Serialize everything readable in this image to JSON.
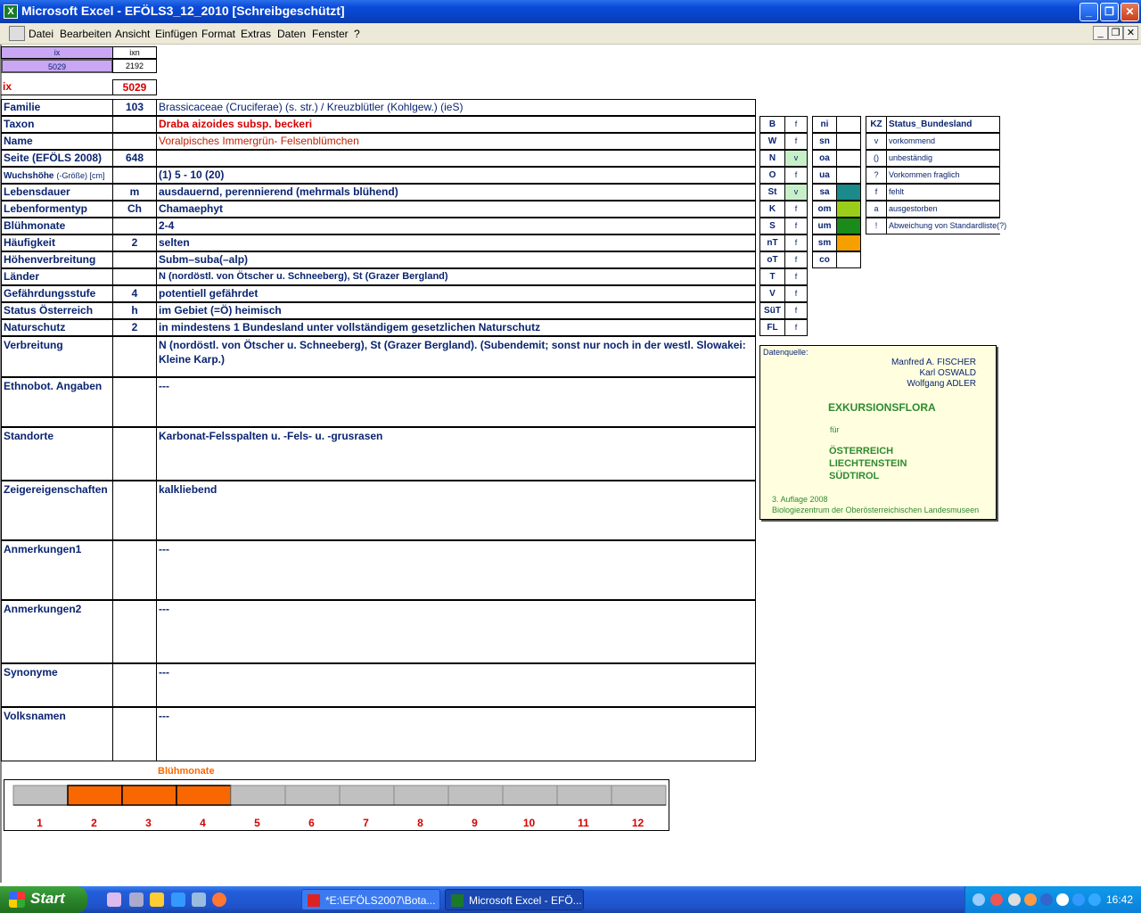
{
  "window": {
    "title": "Microsoft Excel - EFÖLS3_12_2010  [Schreibgeschützt]",
    "icon": "excel-icon"
  },
  "menu": [
    "Datei",
    "Bearbeiten",
    "Ansicht",
    "Einfügen",
    "Format",
    "Extras",
    "Daten",
    "Fenster",
    "?"
  ],
  "top_cells": {
    "ix_hdr": "ix",
    "ixn_hdr": "ixn",
    "ix_val": "5029",
    "ixn_val": "2192",
    "ix_label": "ix",
    "ix_big": "5029"
  },
  "rows": [
    {
      "label": "Familie",
      "code": "103",
      "value": "Brassicaceae (Cruciferae) (s. str.)  /  Kreuzblütler (Kohlgew.) (ieS)"
    },
    {
      "label": "Taxon",
      "code": "",
      "value": "Draba aizoides subsp. beckeri"
    },
    {
      "label": "Name",
      "code": "",
      "value": "Voralpisches Immergrün- Felsenblümchen"
    },
    {
      "label": "Seite (EFÖLS 2008)",
      "code": "648",
      "value": ""
    },
    {
      "label": "Wuchshöhe",
      "label_suffix": "(-Größe) [cm]",
      "code": "",
      "value": " (1) 5 - 10 (20)"
    },
    {
      "label": "Lebensdauer",
      "code": "m",
      "value": "ausdauernd, perennierend (mehrmals blühend)"
    },
    {
      "label": "Lebenformentyp",
      "code": "Ch",
      "value": "Chamaephyt"
    },
    {
      "label": "Blühmonate",
      "code": "",
      "value": " 2-4"
    },
    {
      "label": "Häufigkeit",
      "code": "2",
      "value": "selten"
    },
    {
      "label": "Höhenverbreitung",
      "code": "",
      "value": "Subm–suba(–alp)"
    },
    {
      "label": "Länder",
      "code": "",
      "value": "N (nordöstl. von Ötscher u. Schneeberg), St (Grazer Bergland)"
    },
    {
      "label": "Gefährdungsstufe",
      "code": "4",
      "value": "potentiell gefährdet"
    },
    {
      "label": "Status Österreich",
      "code": "h",
      "value": "im Gebiet (=Ö) heimisch"
    },
    {
      "label": "Naturschutz",
      "code": "2",
      "value": "in mindestens 1 Bundesland unter vollständigem gesetzlichen Naturschutz"
    }
  ],
  "tall_rows": [
    {
      "label": "Verbreitung",
      "value": "N (nordöstl. von Ötscher u. Schneeberg), St (Grazer Bergland). (Subendemit; sonst nur noch in der westl. Slowakei:",
      "value2": "Kleine Karp.)"
    },
    {
      "label": "Ethnobot. Angaben",
      "value": "---",
      "value2": ""
    },
    {
      "label": "Standorte",
      "value": "Karbonat-Felsspalten u. -Fels- u. -grusrasen",
      "value2": ""
    },
    {
      "label": "Zeigereigenschaften",
      "value": "kalkliebend",
      "value2": ""
    },
    {
      "label": "Anmerkungen1",
      "value": "---",
      "value2": ""
    },
    {
      "label": "Anmerkungen2",
      "value": "---",
      "value2": ""
    },
    {
      "label": "Synonyme",
      "value": "---",
      "value2": ""
    },
    {
      "label": "Volksnamen",
      "value": "---",
      "value2": ""
    }
  ],
  "states": [
    {
      "code": "B",
      "v": "f"
    },
    {
      "code": "W",
      "v": "f"
    },
    {
      "code": "N",
      "v": "v"
    },
    {
      "code": "O",
      "v": "f"
    },
    {
      "code": "St",
      "v": "v"
    },
    {
      "code": "K",
      "v": "f"
    },
    {
      "code": "S",
      "v": "f"
    },
    {
      "code": "nT",
      "v": "f"
    },
    {
      "code": "oT",
      "v": "f"
    },
    {
      "code": "T",
      "v": "f"
    },
    {
      "code": "V",
      "v": "f"
    },
    {
      "code": "SüT",
      "v": "f"
    },
    {
      "code": "FL",
      "v": "f"
    }
  ],
  "altitude": [
    {
      "code": "ni",
      "color": ""
    },
    {
      "code": "sn",
      "color": ""
    },
    {
      "code": "oa",
      "color": ""
    },
    {
      "code": "ua",
      "color": ""
    },
    {
      "code": "sa",
      "color": "#1a8a8a"
    },
    {
      "code": "om",
      "color": "#9acd1a"
    },
    {
      "code": "um",
      "color": "#1a8a1a"
    },
    {
      "code": "sm",
      "color": "#f5a000"
    },
    {
      "code": "co",
      "color": ""
    }
  ],
  "legend": {
    "hdr_kz": "KZ",
    "hdr_status": "Status_Bundesland",
    "items": [
      {
        "kz": "v",
        "text": "vorkommend"
      },
      {
        "kz": "()",
        "text": "unbeständig"
      },
      {
        "kz": "?",
        "text": "Vorkommen fraglich"
      },
      {
        "kz": "f",
        "text": "fehlt"
      },
      {
        "kz": "a",
        "text": "ausgestorben"
      },
      {
        "kz": "!",
        "text": "Abweichung von Standardliste(?)"
      }
    ]
  },
  "source": {
    "label": "Datenquelle:",
    "authors": [
      "Manfred A. FISCHER",
      "Karl OSWALD",
      "Wolfgang ADLER"
    ],
    "title": "EXKURSIONSFLORA",
    "fuer": "für",
    "regions": [
      "ÖSTERREICH",
      "LIECHTENSTEIN",
      "SÜDTIROL"
    ],
    "edition": "3. Auflage 2008",
    "publisher": "Biologiezentrum der Oberösterreichischen Landesmuseen"
  },
  "chart_data": {
    "type": "bar",
    "title": "Blühmonate",
    "categories": [
      "1",
      "2",
      "3",
      "4",
      "5",
      "6",
      "7",
      "8",
      "9",
      "10",
      "11",
      "12"
    ],
    "values": [
      0,
      1,
      1,
      1,
      0,
      0,
      0,
      0,
      0,
      0,
      0,
      0
    ],
    "colors": {
      "active": "#f96800",
      "inactive": "#c0c0c0",
      "labels": "#d40000"
    }
  },
  "taskbar": {
    "start": "Start",
    "tasks": [
      "*E:\\EFÖLS2007\\Bota...",
      "Microsoft Excel - EFÖ..."
    ],
    "clock": "16:42"
  }
}
